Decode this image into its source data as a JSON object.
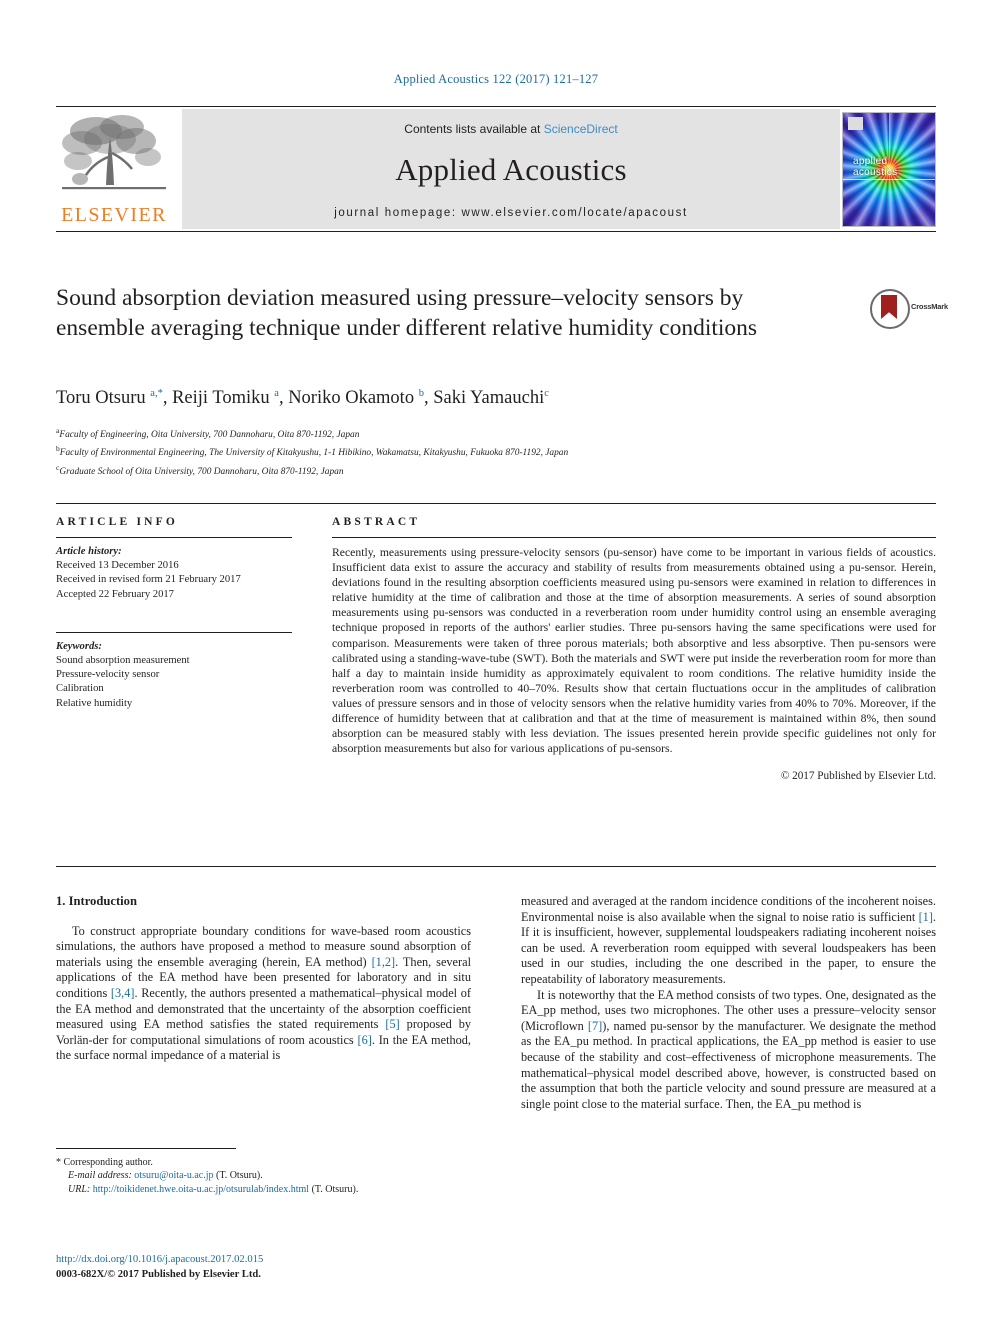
{
  "running_head": "Applied Acoustics 122 (2017) 121–127",
  "masthead": {
    "contents_prefix": "Contents lists available at ",
    "sciencedirect": "ScienceDirect",
    "journal_name": "Applied Acoustics",
    "homepage": "journal homepage: www.elsevier.com/locate/apacoust",
    "publisher_logo_text": "ELSEVIER",
    "cover_title": "applied\nacoustics"
  },
  "article": {
    "title": "Sound absorption deviation measured using pressure–velocity sensors by ensemble averaging technique under different relative humidity conditions",
    "crossmark_label": "CrossMark",
    "authors_html": "Toru Otsuru <sup>a,*</sup>, Reiji Tomiku <sup>a</sup>, Noriko Okamoto <sup>b</sup>, Saki Yamauchi<sup>c</sup>",
    "affiliations": [
      "Faculty of Engineering, Oita University, 700 Dannoharu, Oita 870-1192, Japan",
      "Faculty of Environmental Engineering, The University of Kitakyushu, 1-1 Hibikino, Wakamatsu, Kitakyushu, Fukuoka 870-1192, Japan",
      "Graduate School of Oita University, 700 Dannoharu, Oita 870-1192, Japan"
    ],
    "affiliation_marks": [
      "a",
      "b",
      "c"
    ]
  },
  "article_info": {
    "heading": "ARTICLE INFO",
    "history_title": "Article history:",
    "history": [
      "Received 13 December 2016",
      "Received in revised form 21 February 2017",
      "Accepted 22 February 2017"
    ],
    "keywords_title": "Keywords:",
    "keywords": [
      "Sound absorption measurement",
      "Pressure-velocity sensor",
      "Calibration",
      "Relative humidity"
    ]
  },
  "abstract": {
    "heading": "ABSTRACT",
    "text": "Recently, measurements using pressure-velocity sensors (pu-sensor) have come to be important in various fields of acoustics. Insufficient data exist to assure the accuracy and stability of results from measurements obtained using a pu-sensor. Herein, deviations found in the resulting absorption coefficients measured using pu-sensors were examined in relation to differences in relative humidity at the time of calibration and those at the time of absorption measurements. A series of sound absorption measurements using pu-sensors was conducted in a reverberation room under humidity control using an ensemble averaging technique proposed in reports of the authors' earlier studies. Three pu-sensors having the same specifications were used for comparison. Measurements were taken of three porous materials; both absorptive and less absorptive. Then pu-sensors were calibrated using a standing-wave-tube (SWT). Both the materials and SWT were put inside the reverberation room for more than half a day to maintain inside humidity as approximately equivalent to room conditions. The relative humidity inside the reverberation room was controlled to 40–70%. Results show that certain fluctuations occur in the amplitudes of calibration values of pressure sensors and in those of velocity sensors when the relative humidity varies from 40% to 70%. Moreover, if the difference of humidity between that at calibration and that at the time of measurement is maintained within 8%, then sound absorption can be measured stably with less deviation. The issues presented herein provide specific guidelines not only for absorption measurements but also for various applications of pu-sensors.",
    "copyright": "© 2017 Published by Elsevier Ltd."
  },
  "introduction": {
    "heading": "1. Introduction",
    "left_paragraph_1_a": "To construct appropriate boundary conditions for wave-based room acoustics simulations, the authors have proposed a method to measure sound absorption of materials using the ensemble averaging (herein, EA method) ",
    "ref_1_2": "[1,2]",
    "left_paragraph_1_b": ". Then, several applications of the EA method have been presented for laboratory and in situ conditions ",
    "ref_3_4": "[3,4]",
    "left_paragraph_1_c": ". Recently, the authors presented a mathematical–physical model of the EA method and demonstrated that the uncertainty of the absorption coefficient measured using EA method satisfies the stated requirements ",
    "ref_5": "[5]",
    "left_paragraph_1_d": " proposed by Vorlän-der for computational simulations of room acoustics ",
    "ref_6": "[6]",
    "left_paragraph_1_e": ". In the EA method, the surface normal impedance of a material is",
    "right_paragraph_1_a": "measured and averaged at the random incidence conditions of the incoherent noises. Environmental noise is also available when the signal to noise ratio is sufficient ",
    "ref_1": "[1]",
    "right_paragraph_1_b": ". If it is insufficient, however, supplemental loudspeakers radiating incoherent noises can be used. A reverberation room equipped with several loudspeakers has been used in our studies, including the one described in the paper, to ensure the repeatability of laboratory measurements.",
    "right_paragraph_2_a": "It is noteworthy that the EA method consists of two types. One, designated as the EA_pp method, uses two microphones. The other uses a pressure–velocity sensor (Microflown ",
    "ref_7": "[7]",
    "right_paragraph_2_b": "), named pu-sensor by the manufacturer. We designate the method as the EA_pu method. In practical applications, the EA_pp method is easier to use because of the stability and cost–effectiveness of microphone measurements. The mathematical–physical model described above, however, is constructed based on the assumption that both the particle velocity and sound pressure are measured at a single point close to the material surface. Then, the EA_pu method is"
  },
  "footnotes": {
    "corresponding_mark": "*",
    "corresponding_text": "Corresponding author.",
    "email_label": "E-mail address:",
    "email": "otsuru@oita-u.ac.jp",
    "email_attrib": "(T. Otsuru).",
    "url_label": "URL:",
    "url": "http://toikidenet.hwe.oita-u.ac.jp/otsurulab/index.html",
    "url_attrib": "(T. Otsuru)."
  },
  "footer": {
    "doi": "http://dx.doi.org/10.1016/j.apacoust.2017.02.015",
    "issn_line": "0003-682X/© 2017 Published by Elsevier Ltd."
  },
  "colors": {
    "link_blue": "#1a6d9e",
    "sciencedirect_blue": "#3f8cc9",
    "elsevier_orange": "#ef7d22",
    "band_gray": "#e3e3e3"
  }
}
